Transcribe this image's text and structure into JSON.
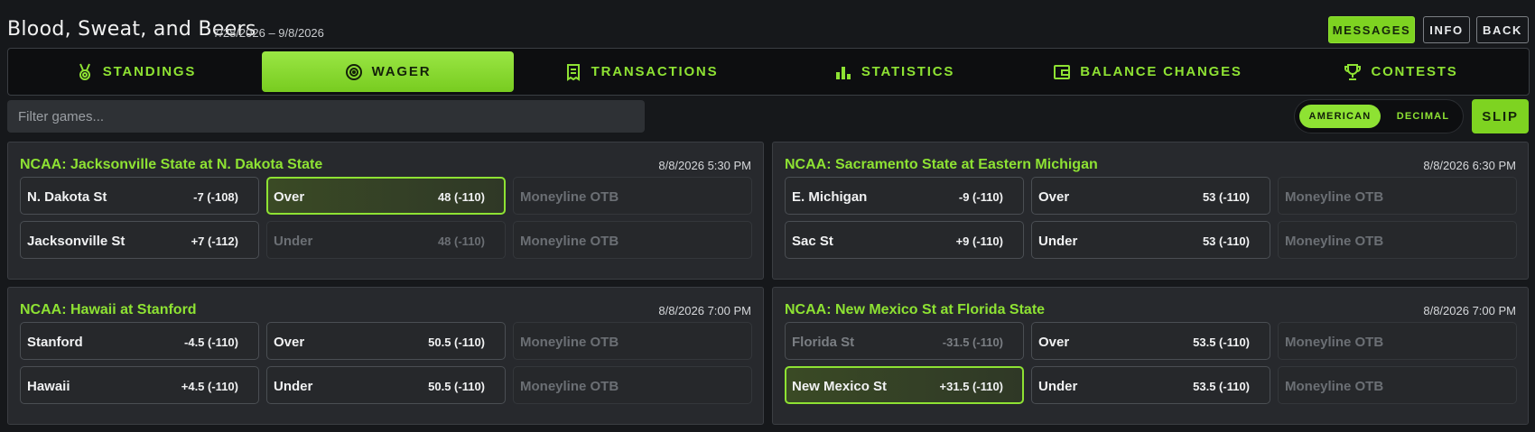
{
  "header": {
    "title": "Blood, Sweat, and Beers",
    "dates": "7/28/2026 – 9/8/2026",
    "buttons": {
      "messages": "MESSAGES",
      "info": "INFO",
      "back": "BACK"
    }
  },
  "nav": {
    "tabs": [
      {
        "label": "STANDINGS",
        "icon": "medal-icon"
      },
      {
        "label": "WAGER",
        "icon": "target-icon",
        "active": true
      },
      {
        "label": "TRANSACTIONS",
        "icon": "receipt-icon"
      },
      {
        "label": "STATISTICS",
        "icon": "bar-chart-icon"
      },
      {
        "label": "BALANCE CHANGES",
        "icon": "wallet-icon"
      },
      {
        "label": "CONTESTS",
        "icon": "trophy-icon"
      }
    ]
  },
  "filter": {
    "placeholder": "Filter games...",
    "value": ""
  },
  "odds_format": {
    "american": "AMERICAN",
    "decimal": "DECIMAL",
    "selected": "AMERICAN"
  },
  "slip_label": "SLIP",
  "colors": {
    "accent": "#8ee233",
    "background": "#16181b",
    "card": "#27292d"
  },
  "games": [
    {
      "title": "NCAA: Jacksonville State at N. Dakota State",
      "time": "8/8/2026 5:30 PM",
      "spread": [
        {
          "name": "N. Dakota St",
          "odds": "-7 (-108)"
        },
        {
          "name": "Jacksonville St",
          "odds": "+7 (-112)"
        }
      ],
      "total": [
        {
          "name": "Over",
          "odds": "48 (-110)",
          "state": "selected"
        },
        {
          "name": "Under",
          "odds": "48 (-110)",
          "state": "dim"
        }
      ],
      "moneyline": [
        "Moneyline OTB",
        "Moneyline OTB"
      ]
    },
    {
      "title": "NCAA: Sacramento State at Eastern Michigan",
      "time": "8/8/2026 6:30 PM",
      "spread": [
        {
          "name": "E. Michigan",
          "odds": "-9 (-110)"
        },
        {
          "name": "Sac St",
          "odds": "+9 (-110)"
        }
      ],
      "total": [
        {
          "name": "Over",
          "odds": "53 (-110)"
        },
        {
          "name": "Under",
          "odds": "53 (-110)"
        }
      ],
      "moneyline": [
        "Moneyline OTB",
        "Moneyline OTB"
      ]
    },
    {
      "title": "NCAA: Hawaii at Stanford",
      "time": "8/8/2026 7:00 PM",
      "spread": [
        {
          "name": "Stanford",
          "odds": "-4.5 (-110)"
        },
        {
          "name": "Hawaii",
          "odds": "+4.5 (-110)"
        }
      ],
      "total": [
        {
          "name": "Over",
          "odds": "50.5 (-110)"
        },
        {
          "name": "Under",
          "odds": "50.5 (-110)"
        }
      ],
      "moneyline": [
        "Moneyline OTB",
        "Moneyline OTB"
      ]
    },
    {
      "title": "NCAA: New Mexico St at Florida State",
      "time": "8/8/2026 7:00 PM",
      "spread": [
        {
          "name": "Florida St",
          "odds": "-31.5 (-110)",
          "state": "faint"
        },
        {
          "name": "New Mexico St",
          "odds": "+31.5 (-110)",
          "state": "selected"
        }
      ],
      "total": [
        {
          "name": "Over",
          "odds": "53.5 (-110)"
        },
        {
          "name": "Under",
          "odds": "53.5 (-110)"
        }
      ],
      "moneyline": [
        "Moneyline OTB",
        "Moneyline OTB"
      ]
    }
  ]
}
